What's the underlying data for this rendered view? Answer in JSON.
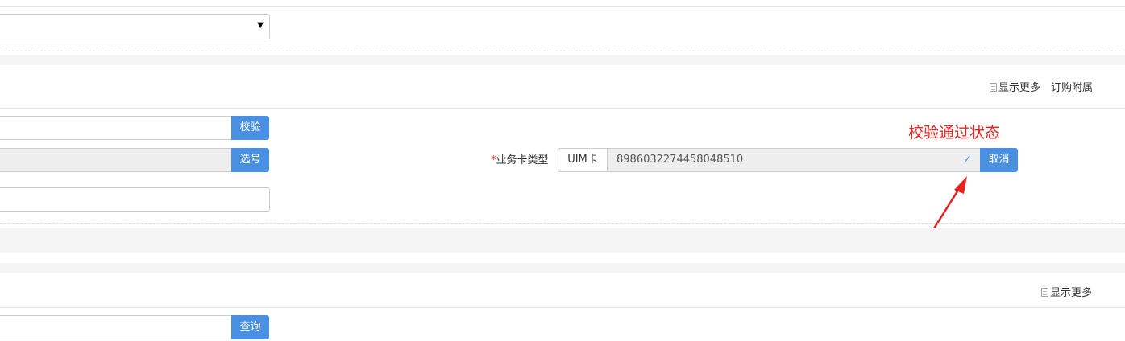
{
  "section1": {
    "select": {
      "value": "",
      "arrow": "▼"
    }
  },
  "section2": {
    "header_links": [
      {
        "icon": "document-icon",
        "label": "显示更多"
      },
      {
        "label": "订购附属"
      }
    ],
    "verify_button": "校验",
    "select_number_button": "选号",
    "card_type": {
      "required_mark": "*",
      "label": "业务卡类型",
      "prefix": "UIM卡",
      "value": "8986032274458048510",
      "status_icon": "check-icon",
      "cancel_button": "取消"
    },
    "annotation": {
      "text": "校验通过状态",
      "color": "#e8231f"
    }
  },
  "section3": {
    "header_links": [
      {
        "icon": "document-icon",
        "label": "显示更多"
      }
    ],
    "query_button": "查询"
  },
  "colors": {
    "primary_button": "#4a90e2",
    "readonly_bg": "#eeeeee",
    "band_bg": "#f5f5f5",
    "annotation": "#e8231f"
  }
}
